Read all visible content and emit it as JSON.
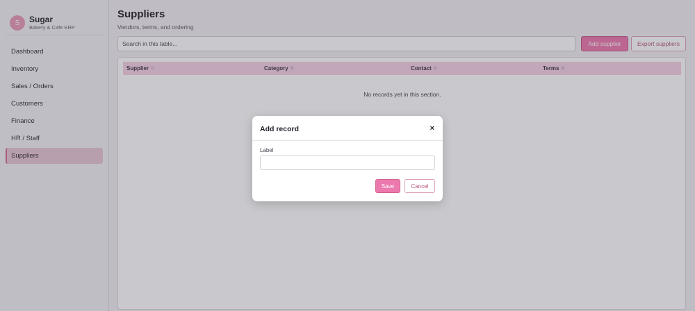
{
  "brand": {
    "avatar_letter": "S",
    "name": "Sugar",
    "subtitle": "Bakery & Cafe ERP"
  },
  "sidebar": {
    "items": [
      {
        "label": "Dashboard",
        "active": false
      },
      {
        "label": "Inventory",
        "active": false
      },
      {
        "label": "Sales / Orders",
        "active": false
      },
      {
        "label": "Customers",
        "active": false
      },
      {
        "label": "Finance",
        "active": false
      },
      {
        "label": "HR / Staff",
        "active": false
      },
      {
        "label": "Suppliers",
        "active": true
      }
    ]
  },
  "header": {
    "title": "Suppliers",
    "subtitle": "Vendors, terms, and ordering"
  },
  "toolbar": {
    "search_placeholder": "Search in this table...",
    "add_label": "Add supplier",
    "export_label": "Export suppliers"
  },
  "table": {
    "columns": [
      {
        "label": "Supplier",
        "sort_glyph": "⇅"
      },
      {
        "label": "Category",
        "sort_glyph": "⇅"
      },
      {
        "label": "Contact",
        "sort_glyph": "⇅"
      },
      {
        "label": "Terms",
        "sort_glyph": "⇅"
      }
    ],
    "rows": [],
    "empty_message": "No records yet in this section."
  },
  "modal": {
    "title": "Add record",
    "close_glyph": "×",
    "field_label": "Label",
    "field_value": "",
    "save_label": "Save",
    "cancel_label": "Cancel"
  },
  "colors": {
    "accent": "#ec79ad",
    "accent_border": "#c45a8a",
    "table_header_bg": "#f6d2e3",
    "active_nav_bg": "#e8c7d6",
    "overlay": "rgba(60,56,72,0.28)"
  }
}
